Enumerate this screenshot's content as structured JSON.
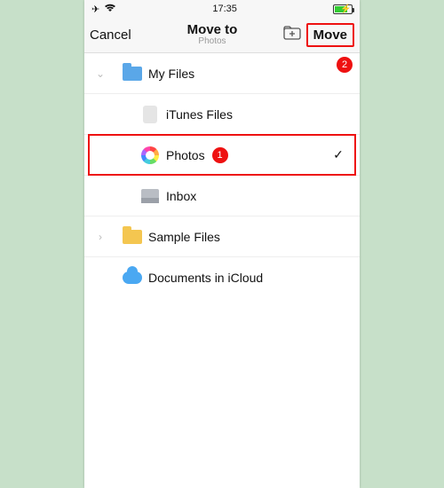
{
  "status": {
    "time": "17:35"
  },
  "nav": {
    "cancel": "Cancel",
    "title": "Move to",
    "subtitle": "Photos",
    "move": "Move"
  },
  "badges": {
    "one": "1",
    "two": "2"
  },
  "rows": {
    "myfiles": "My Files",
    "itunes": "iTunes Files",
    "photos": "Photos",
    "inbox": "Inbox",
    "sample": "Sample Files",
    "icloud": "Documents in iCloud"
  }
}
